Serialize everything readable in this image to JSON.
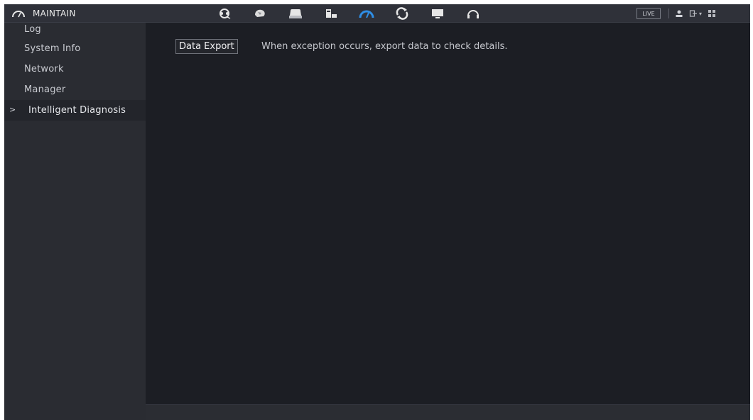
{
  "header": {
    "title": "MAINTAIN",
    "title_icon": "gauge-icon",
    "modules": [
      {
        "icon": "camera-settings-icon",
        "active": false
      },
      {
        "icon": "network-globe-icon",
        "active": false
      },
      {
        "icon": "storage-disk-icon",
        "active": false
      },
      {
        "icon": "system-icon",
        "active": false
      },
      {
        "icon": "maintain-gauge-icon",
        "active": true
      },
      {
        "icon": "backup-sync-icon",
        "active": false
      },
      {
        "icon": "display-monitor-icon",
        "active": false
      },
      {
        "icon": "audio-headset-icon",
        "active": false
      }
    ],
    "live_label": "LIVE",
    "accent_color": "#2f8ee6"
  },
  "sidebar": {
    "items": [
      {
        "label": "Log",
        "active": false
      },
      {
        "label": "System Info",
        "active": false
      },
      {
        "label": "Network",
        "active": false
      },
      {
        "label": "Manager",
        "active": false
      },
      {
        "label": "Intelligent Diagnosis",
        "active": true
      }
    ],
    "active_marker": ">"
  },
  "main": {
    "export_button": "Data Export",
    "export_description": "When exception occurs, export data to check details."
  }
}
